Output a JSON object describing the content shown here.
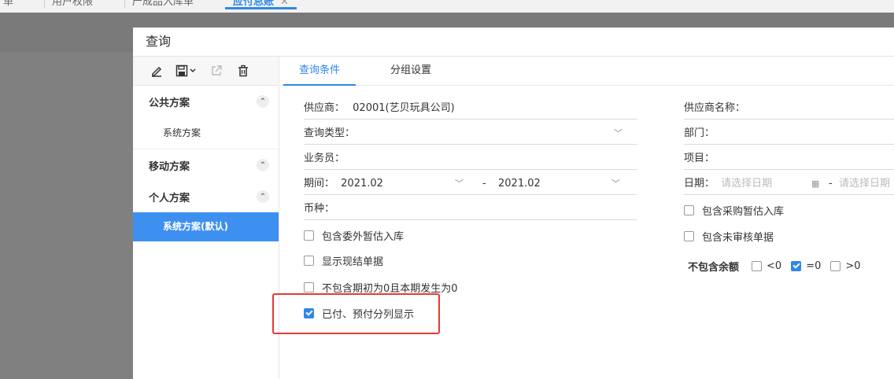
{
  "top_tabs": [
    {
      "label": "单"
    },
    {
      "label": "用户权限"
    },
    {
      "label": "产成品入库单"
    },
    {
      "label": "应付总账",
      "active": true
    }
  ],
  "dialog": {
    "title": "查询"
  },
  "left_panel": {
    "toolbar": {
      "edit": "pencil-icon",
      "save": "save-icon",
      "export": "external-link-icon",
      "delete": "trash-icon"
    },
    "groups": [
      {
        "label": "公共方案",
        "items": [
          "系统方案"
        ]
      },
      {
        "label": "移动方案",
        "items": []
      },
      {
        "label": "个人方案",
        "items": [
          "系统方案(默认)"
        ]
      }
    ]
  },
  "query_tabs": [
    {
      "label": "查询条件",
      "active": true
    },
    {
      "label": "分组设置"
    }
  ],
  "form": {
    "supplier_label": "供应商：",
    "supplier_value": "02001(艺贝玩具公司)",
    "query_type_label": "查询类型：",
    "query_type_value": "",
    "salesman_label": "业务员：",
    "period_label": "期间：",
    "period_from": "2021.02",
    "period_sep": "-",
    "period_to": "2021.02",
    "currency_label": "币种：",
    "supplier_name_label": "供应商名称：",
    "dept_label": "部门：",
    "project_label": "项目：",
    "date_label": "日期：",
    "date_from_placeholder": "请选择日期",
    "date_sep": "-",
    "date_to_placeholder": "请选择日期"
  },
  "checkboxes": [
    {
      "label": "包含委外暂估入库",
      "checked": false
    },
    {
      "label": "显示现结单据",
      "checked": false
    },
    {
      "label": "不包含期初为0且本期发生为0",
      "checked": false
    },
    {
      "label": "已付、预付分列显示",
      "checked": true
    }
  ],
  "right_checkboxes": [
    {
      "label": "包含采购暂估入库",
      "checked": false
    },
    {
      "label": "包含未审核单据",
      "checked": false
    }
  ],
  "exclude_balance": {
    "label": "不包含余额",
    "options": [
      {
        "label": "<0",
        "checked": false
      },
      {
        "label": "=0",
        "checked": true
      },
      {
        "label": ">0",
        "checked": false
      }
    ]
  },
  "colors": {
    "accent": "#2f87e8",
    "selected_bg": "#3d8ff0",
    "highlight": "#e53935"
  }
}
